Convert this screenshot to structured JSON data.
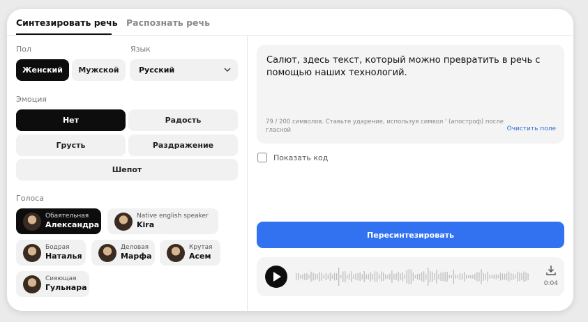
{
  "tabs": [
    {
      "label": "Синтезировать речь",
      "active": true
    },
    {
      "label": "Распознать речь",
      "active": false
    }
  ],
  "gender": {
    "label": "Пол",
    "options": [
      "Женский",
      "Мужской"
    ],
    "selected": "Женский"
  },
  "language": {
    "label": "Язык",
    "value": "Русский"
  },
  "emotion": {
    "label": "Эмоция",
    "options": [
      "Нет",
      "Радость",
      "Грусть",
      "Раздражение",
      "Шепот"
    ],
    "selected": "Нет"
  },
  "voices": {
    "label": "Голоса",
    "items": [
      {
        "descriptor": "Обаятельная",
        "name": "Александра",
        "selected": true
      },
      {
        "descriptor": "Native english speaker",
        "name": "Kira",
        "selected": false
      },
      {
        "descriptor": "Бодрая",
        "name": "Наталья",
        "selected": false
      },
      {
        "descriptor": "Деловая",
        "name": "Марфа",
        "selected": false
      },
      {
        "descriptor": "Крутая",
        "name": "Асем",
        "selected": false
      },
      {
        "descriptor": "Сияющая",
        "name": "Гульнара",
        "selected": false
      }
    ]
  },
  "textbox": {
    "text": "Салют, здесь текст, который можно превратить в речь с помощью наших технологий.",
    "hint": "79 / 200 символов. Ставьте ударение, используя символ ' (апостроф) после гласной",
    "clear_label": "Очистить поле"
  },
  "show_code": {
    "label": "Показать код",
    "checked": false
  },
  "resynth_button": "Пересинтезировать",
  "player": {
    "duration": "0:04",
    "progress": 0
  },
  "colors": {
    "accent": "#3272f1",
    "selected": "#0d0d0d",
    "link": "#2b6cd6"
  }
}
